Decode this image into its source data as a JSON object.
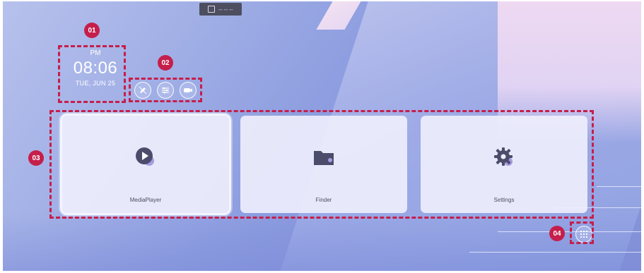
{
  "topbar": {
    "label": "-- -- --",
    "icon": "screen-icon"
  },
  "clock": {
    "ampm": "PM",
    "time": "08:06",
    "date": "TUE, JUN 25"
  },
  "quick_buttons": [
    {
      "name": "pen-icon"
    },
    {
      "name": "sliders-icon"
    },
    {
      "name": "camera-icon"
    }
  ],
  "apps": [
    {
      "label": "MediaPlayer",
      "icon": "play-icon",
      "selected": true
    },
    {
      "label": "Finder",
      "icon": "folder-icon",
      "selected": false
    },
    {
      "label": "Settings",
      "icon": "gear-icon",
      "selected": false
    }
  ],
  "all_apps": {
    "icon": "grid-icon"
  },
  "callouts": {
    "c1": "01",
    "c2": "02",
    "c3": "03",
    "c4": "04"
  },
  "colors": {
    "callout": "#c51f4b",
    "accent": "#6a5fb0"
  }
}
